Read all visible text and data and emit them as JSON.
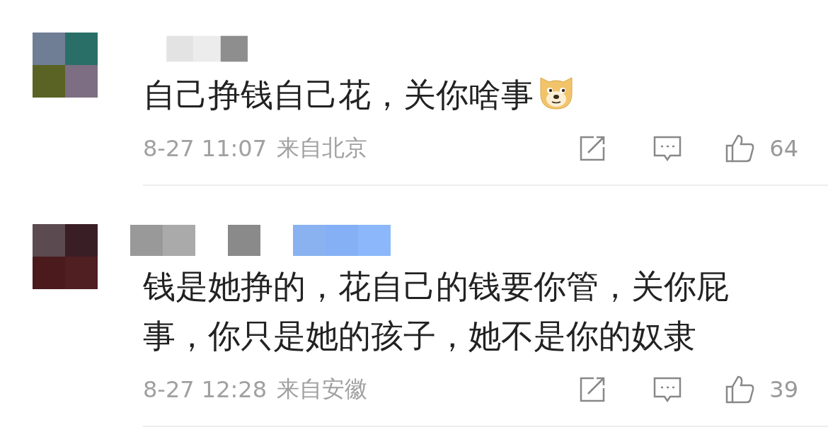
{
  "comments": [
    {
      "text": "自己挣钱自己花，关你啥事",
      "emoji": true,
      "time": "8-27 11:07",
      "location": "来自北京",
      "likes": "64"
    },
    {
      "text": "钱是她挣的，花自己的钱要你管，关你屁事，你只是她的孩子，她不是你的奴隶",
      "emoji": false,
      "time": "8-27 12:28",
      "location": "来自安徽",
      "likes": "39"
    }
  ]
}
